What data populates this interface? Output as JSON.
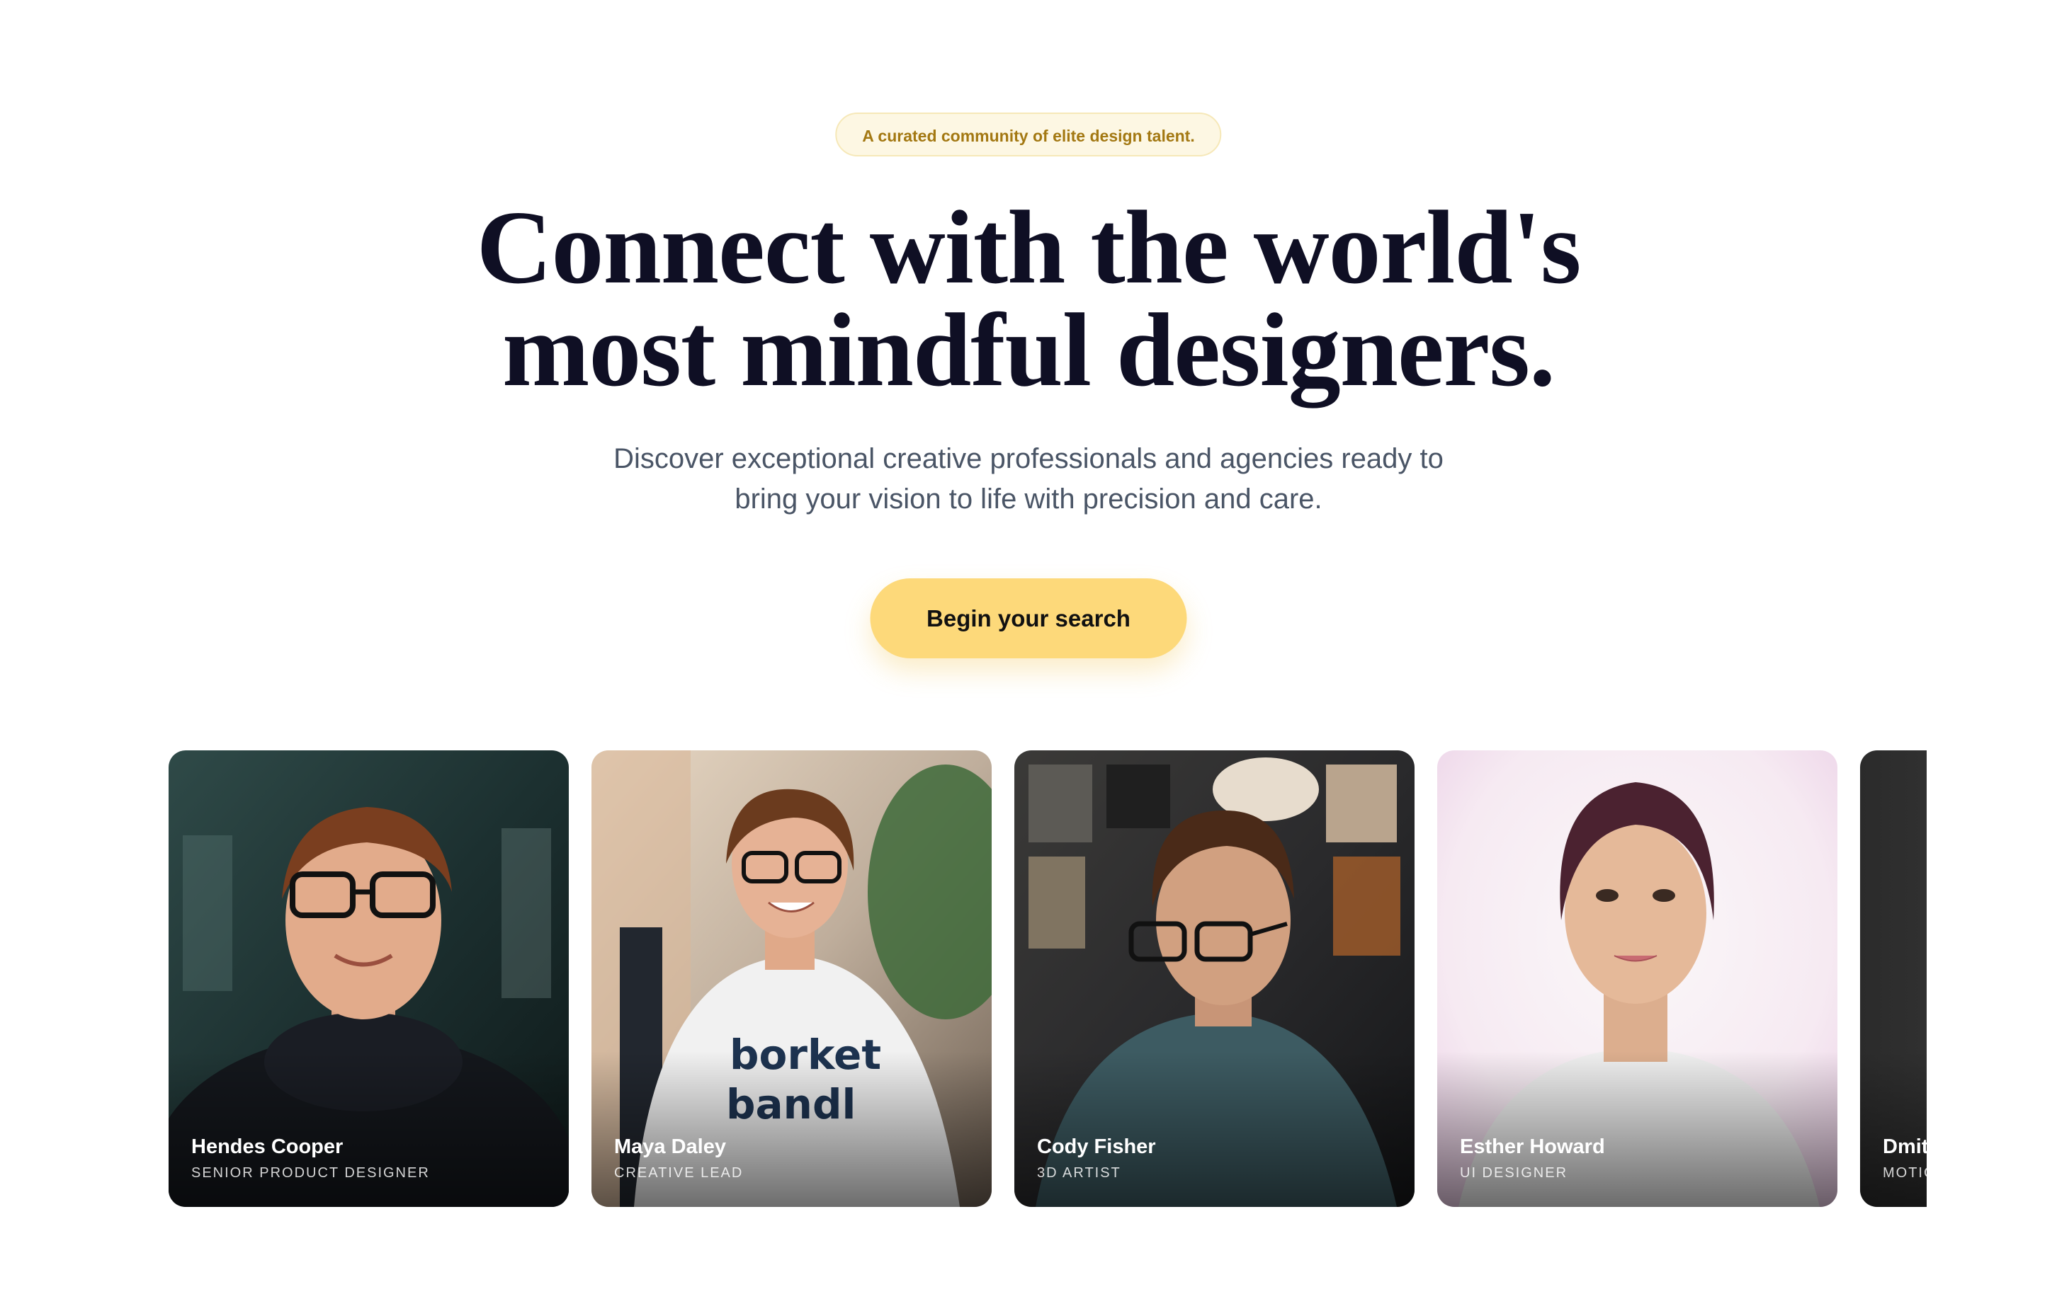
{
  "hero": {
    "badge": "A curated community of elite design talent.",
    "headline_line1": "Connect with the world's",
    "headline_line2": "most mindful designers.",
    "subtitle_line1": "Discover exceptional creative professionals and agencies ready to",
    "subtitle_line2": "bring your vision to life with precision and care.",
    "cta_label": "Begin your search"
  },
  "designers": [
    {
      "name": "Hendes Cooper",
      "role": "Senior Product Designer"
    },
    {
      "name": "Maya Daley",
      "role": "Creative Lead"
    },
    {
      "name": "Cody Fisher",
      "role": "3D Artist"
    },
    {
      "name": "Esther Howard",
      "role": "UI Designer"
    },
    {
      "name": "Dmit",
      "role": "Motio"
    }
  ],
  "colors": {
    "accent": "#fdd97a",
    "badge_text": "#a37812",
    "headline": "#0f0f24",
    "subtitle": "#4a5566"
  }
}
